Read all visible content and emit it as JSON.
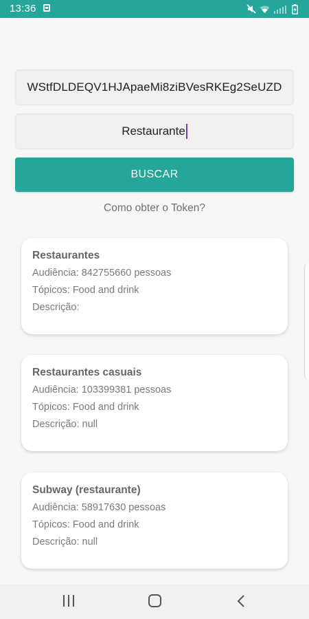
{
  "status_bar": {
    "time": "13:36",
    "icons": [
      "notification-icon",
      "mute-icon",
      "wifi-icon",
      "signal-icon",
      "battery-icon"
    ]
  },
  "form": {
    "token_value": "WStfDLDEQV1HJApaeMi8ziBVesRKEg2SeUZD",
    "search_value": "Restaurante",
    "search_button_label": "BUSCAR",
    "token_help_link": "Como obter o Token?"
  },
  "results": [
    {
      "title": "Restaurantes",
      "audience": "Audiência: 842755660 pessoas",
      "topics": "Tópicos: Food and drink",
      "description": "Descrição:"
    },
    {
      "title": "Restaurantes casuais",
      "audience": "Audiência: 103399381 pessoas",
      "topics": "Tópicos: Food and drink",
      "description": "Descrição: null"
    },
    {
      "title": "Subway (restaurante)",
      "audience": "Audiência: 58917630 pessoas",
      "topics": "Tópicos: Food and drink",
      "description": "Descrição: null"
    }
  ],
  "nav_bar": {
    "icons": [
      "recent-apps-icon",
      "home-icon",
      "back-icon"
    ]
  },
  "colors": {
    "accent": "#26a69a",
    "background": "#f7f7f7",
    "caret": "#6a3fb5"
  }
}
